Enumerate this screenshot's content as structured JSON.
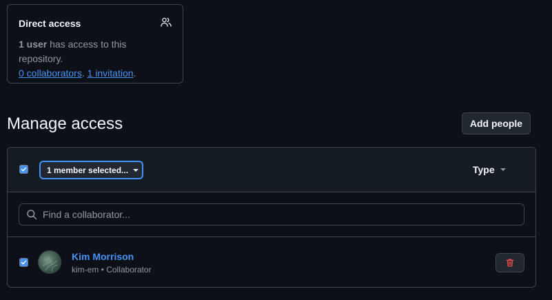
{
  "direct_access": {
    "title": "Direct access",
    "icon": "people-icon",
    "count_bold": "1 user",
    "count_text": " has access to this repository.",
    "collaborators_link": "0 collaborators",
    "separator": ". ",
    "invitations_link": "1 invitation",
    "end": "."
  },
  "manage": {
    "title": "Manage access",
    "add_people_label": "Add people"
  },
  "panel": {
    "select_all_checked": true,
    "selection_label": "1 member selected...",
    "type_filter_label": "Type",
    "search_placeholder": "Find a collaborator...",
    "members": [
      {
        "name": "Kim Morrison",
        "username": "kim-em",
        "role": "Collaborator",
        "meta": "kim-em • Collaborator",
        "checked": true
      }
    ]
  },
  "colors": {
    "background": "#0d1117",
    "link": "#4493f8",
    "danger": "#f85149",
    "border": "#3d444d"
  }
}
